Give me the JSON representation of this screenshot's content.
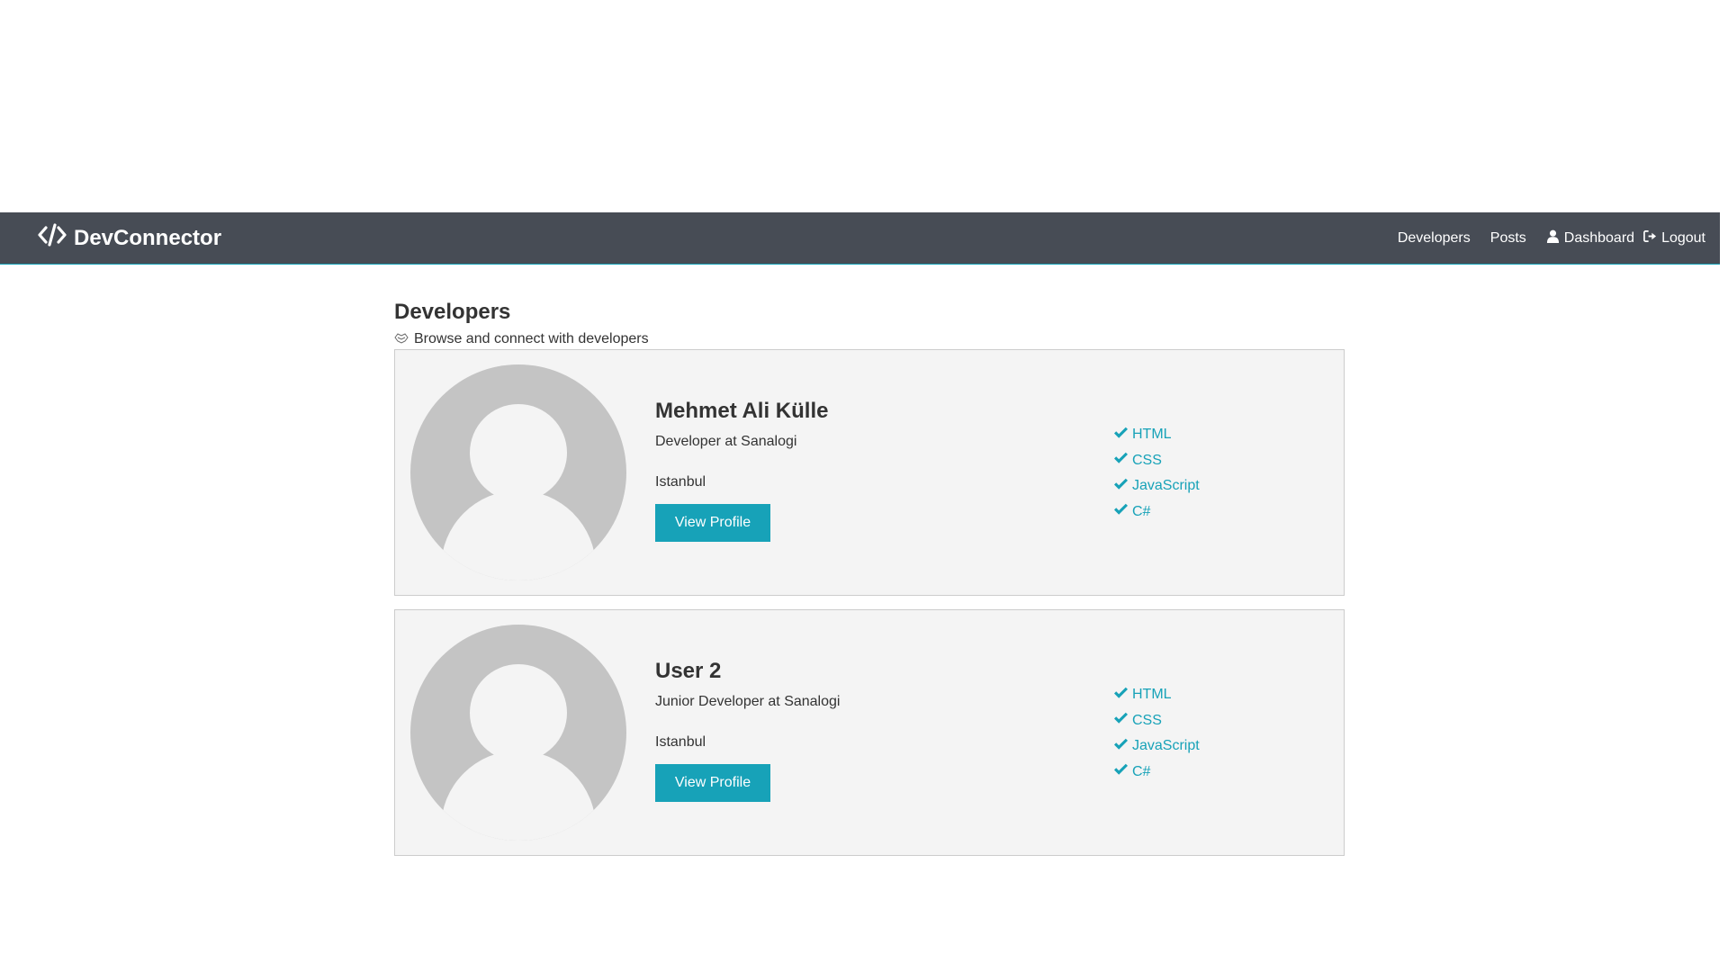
{
  "navbar": {
    "brand": "DevConnector",
    "links": {
      "developers": "Developers",
      "posts": "Posts",
      "dashboard": "Dashboard",
      "logout": "Logout"
    }
  },
  "page": {
    "title": "Developers",
    "lead": "Browse and connect with developers"
  },
  "profiles": [
    {
      "name": "Mehmet Ali Külle",
      "status": "Developer at Sanalogi",
      "location": "Istanbul",
      "button": "View Profile",
      "skills": [
        "HTML",
        "CSS",
        "JavaScript",
        "C#"
      ]
    },
    {
      "name": "User 2",
      "status": "Junior Developer at Sanalogi",
      "location": "Istanbul",
      "button": "View Profile",
      "skills": [
        "HTML",
        "CSS",
        "JavaScript",
        "C#"
      ]
    }
  ],
  "colors": {
    "navbar": "#474c55",
    "primary": "#17a2b8",
    "card_bg": "#f4f4f4",
    "avatar": "#c4c4c4"
  },
  "icons": {
    "brand": "code-icon",
    "lead": "connect-icon",
    "dashboard": "user-icon",
    "logout": "sign-out-icon",
    "skill": "check-icon"
  }
}
